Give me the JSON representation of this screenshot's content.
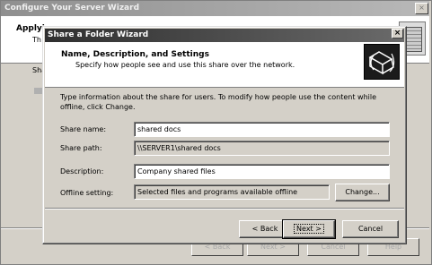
{
  "background_wizard": {
    "title": "Configure Your Server Wizard",
    "close_glyph": "×",
    "heading": "Applyi",
    "subheading": "Th",
    "body_label": "Sha",
    "buttons": {
      "back": "< Back",
      "next": "Next >",
      "cancel": "Cancel",
      "help": "Help"
    }
  },
  "dialog": {
    "title": "Share a Folder Wizard",
    "close_glyph": "×",
    "heading": "Name, Description, and Settings",
    "subheading": "Specify how people see and use this share over the network.",
    "icon": "shared-folder-icon",
    "intro": "Type information about the share for users. To modify how people use the content while offline, click Change.",
    "fields": {
      "share_name": {
        "label": "Share name:",
        "value": "shared docs"
      },
      "share_path": {
        "label": "Share path:",
        "value": "\\\\SERVER1\\shared docs"
      },
      "description": {
        "label": "Description:",
        "value": "Company shared files"
      },
      "offline_setting": {
        "label": "Offline setting:",
        "value": "Selected files and programs available offline"
      }
    },
    "buttons": {
      "change": "Change...",
      "back": "< Back",
      "next": "Next >",
      "cancel": "Cancel"
    }
  }
}
